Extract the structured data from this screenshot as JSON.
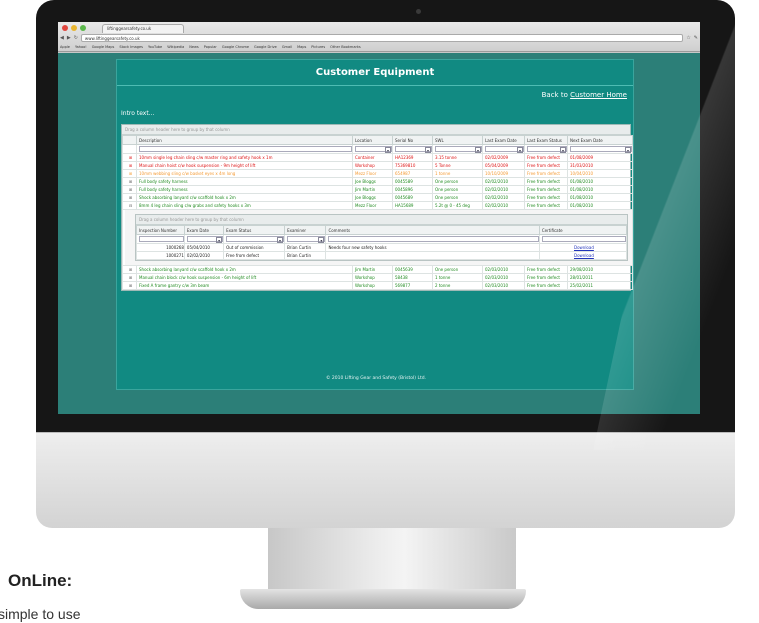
{
  "browser": {
    "tab_title": "liftinggearsafety.co.uk",
    "url": "www.liftinggearsafety.co.uk",
    "bookmarks": [
      "Apple",
      "Yahoo!",
      "Google Maps",
      "Stock Images",
      "YouTube",
      "Wikipedia",
      "News",
      "Popular",
      "Google Chrome",
      "Google Drive",
      "Gmail",
      "Maps",
      "Pictures",
      "Other Bookmarks"
    ]
  },
  "page": {
    "title": "Customer Equipment",
    "back_prefix": "Back to ",
    "back_link": "Customer Home",
    "intro": "Intro text...",
    "group_hint": "Drag a column header here to group by that column",
    "footer": "© 2010 Lifting Gear and Safety (Bristol) Ltd."
  },
  "grid": {
    "columns": [
      "Description",
      "Location",
      "Serial No",
      "SWL",
      "Last Exam Date",
      "Last Exam Status",
      "Next Exam Date"
    ],
    "rows": [
      {
        "status": "red",
        "cells": [
          "10mm single leg chain sling c/w master ring and safety hook x 1m",
          "Container",
          "HA12369",
          "3.15 tonne",
          "02/02/2009",
          "Free from defect",
          "01/08/2009"
        ]
      },
      {
        "status": "red",
        "cells": [
          "Manual chain hoist c/w hook suspension - 9m height of lift",
          "Workshop",
          "75369810",
          "5 Tonne",
          "05/04/2009",
          "Free from defect",
          "31/03/2010"
        ]
      },
      {
        "status": "orange",
        "cells": [
          "10mm webbing sling c/w basket eyes x 4m long",
          "Mezz Floor",
          "654987",
          "1 tonne",
          "10/10/2009",
          "Free from defect",
          "10/04/2010"
        ]
      },
      {
        "status": "green",
        "cells": [
          "Full body safety harness",
          "Joe Bloggs",
          "0045589",
          "One person",
          "02/02/2010",
          "Free from defect",
          "01/08/2010"
        ]
      },
      {
        "status": "green",
        "cells": [
          "Full body safety harness",
          "Jim Martin",
          "0045896",
          "One person",
          "02/02/2010",
          "Free from defect",
          "01/08/2010"
        ]
      },
      {
        "status": "green",
        "cells": [
          "Shock absorbing lanyard c/w scaffold hook x 2m",
          "Joe Bloggs",
          "0045689",
          "One person",
          "02/02/2010",
          "Free from defect",
          "01/08/2010"
        ]
      },
      {
        "status": "green",
        "cells": [
          "8mm 4 leg chain sling c/w grabs and safety hooks x 3m",
          "Mezz Floor",
          "HA15689",
          "5.2t @ 0 - 45 deg",
          "02/02/2010",
          "Free from defect",
          "01/08/2010"
        ]
      }
    ],
    "detail": {
      "group_hint": "Drag a column header here to group by that column",
      "columns": [
        "Inspection Number",
        "Exam Date",
        "Exam Status",
        "Examiner",
        "Comments",
        "Certificate"
      ],
      "rows": [
        {
          "cells": [
            "1000268",
            "05/04/2010",
            "Out of commission",
            "Brian Curtin",
            "Needs four new safety hooks"
          ],
          "certificate": "Download"
        },
        {
          "cells": [
            "1000271",
            "02/02/2010",
            "Free from defect",
            "Brian Curtin",
            ""
          ],
          "certificate": "Download"
        }
      ]
    },
    "rows_after": [
      {
        "status": "green",
        "cells": [
          "Shock absorbing lanyard c/w scaffold hook x 2m",
          "Jim Martin",
          "0045639",
          "One person",
          "02/03/2010",
          "Free from defect",
          "29/08/2010"
        ]
      },
      {
        "status": "green",
        "cells": [
          "Manual chain block c/w hook suspension - 6m height of lift",
          "Workshop",
          "58438",
          "1 tonne",
          "02/03/2010",
          "Free from defect",
          "28/01/2011"
        ]
      },
      {
        "status": "green",
        "cells": [
          "Fixed A frame gantry c/w 3m beam",
          "Workshop",
          "569877",
          "2 tonne",
          "02/03/2010",
          "Free from defect",
          "25/02/2011"
        ]
      }
    ]
  },
  "caption": {
    "heading": "OnLine:",
    "sub": "simple to use"
  },
  "colors": {
    "page_bg": "#2c7f78",
    "panel_bg": "#118a82",
    "overdue": "#dd1111",
    "due_soon": "#f49a33",
    "ok": "#1f8a1f"
  }
}
